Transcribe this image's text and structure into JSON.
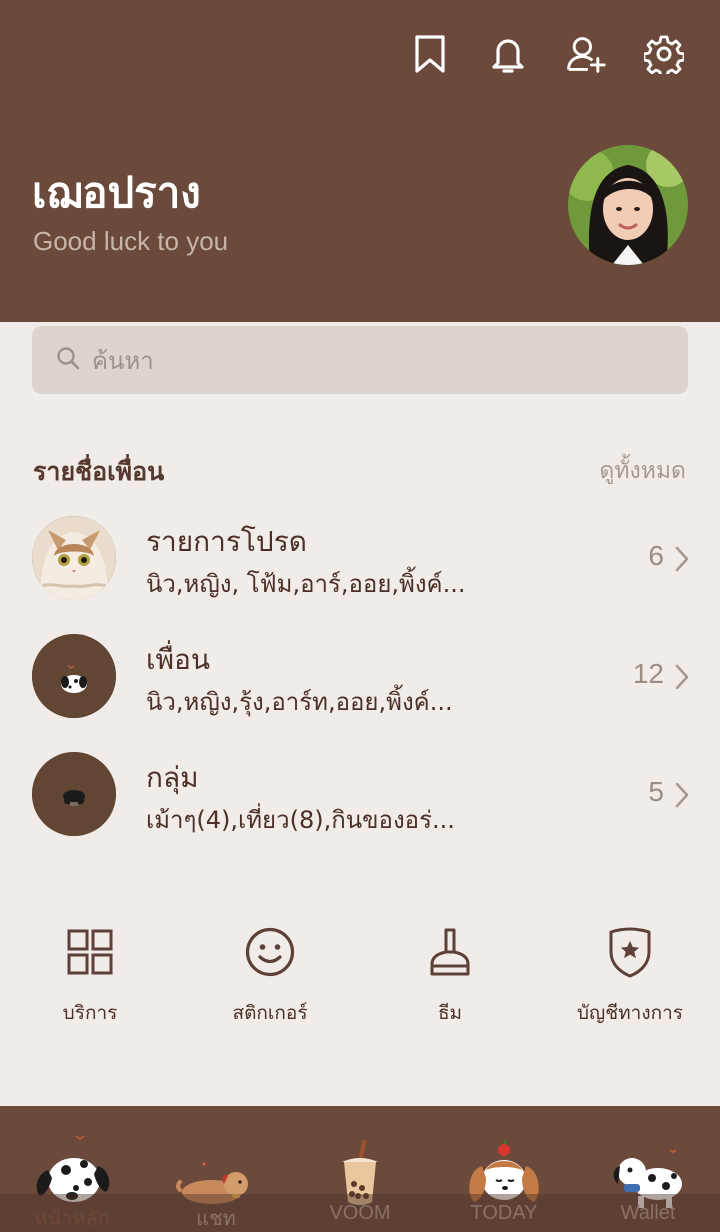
{
  "colors": {
    "header_bg": "#6b4a3c",
    "body_bg": "#f1ece7",
    "search_bg": "#dcd4cf",
    "text_brown": "#4c3027",
    "muted": "#9b8d84"
  },
  "header": {
    "icons": [
      "bookmark-icon",
      "bell-icon",
      "add-friend-icon",
      "settings-icon"
    ]
  },
  "profile": {
    "name": "เฌอปราง",
    "status": "Good luck to you"
  },
  "search": {
    "placeholder": "ค้นหา"
  },
  "friends": {
    "title": "รายชื่อเพื่อน",
    "see_all": "ดูทั้งหมด",
    "rows": [
      {
        "title": "รายการโปรด",
        "subtitle": "นิว,หญิง, โฟ้ม,อาร์,ออย,พิ้งค์...",
        "count": "6"
      },
      {
        "title": "เพื่อน",
        "subtitle": "นิว,หญิง,รุ้ง,อาร์ท,ออย,พิ้งค์...",
        "count": "12"
      },
      {
        "title": "กลุ่ม",
        "subtitle": "เม้าๆ(4),เที่ยว(8),กินของอร่...",
        "count": "5"
      }
    ]
  },
  "shortcuts": [
    {
      "label": "บริการ",
      "icon": "services-grid-icon"
    },
    {
      "label": "สติกเกอร์",
      "icon": "smiley-icon"
    },
    {
      "label": "ธีม",
      "icon": "paint-brush-icon"
    },
    {
      "label": "บัญชีทางการ",
      "icon": "shield-star-icon"
    }
  ],
  "bottom_nav": [
    {
      "label": "หน้าหลัก",
      "icon": "dalmatian-dog-icon",
      "active": true
    },
    {
      "label": "แชท",
      "icon": "sleeping-dog-icon"
    },
    {
      "label": "VOOM",
      "icon": "bubble-tea-icon"
    },
    {
      "label": "TODAY",
      "icon": "spaniel-dog-icon"
    },
    {
      "label": "Wallet",
      "icon": "dalmatian-scarf-icon"
    }
  ]
}
